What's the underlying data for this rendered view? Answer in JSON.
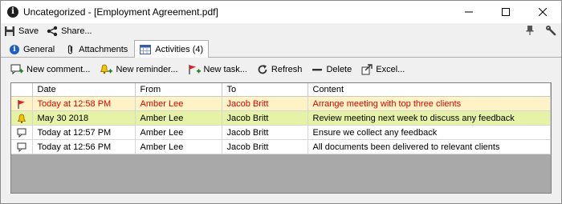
{
  "window": {
    "title": "Uncategorized - [Employment Agreement.pdf]"
  },
  "toolbar": {
    "save_label": "Save",
    "share_label": "Share..."
  },
  "tabs": [
    {
      "label": "General",
      "icon": "info-icon"
    },
    {
      "label": "Attachments",
      "icon": "paperclip-icon"
    },
    {
      "label": "Activities (4)",
      "icon": "calendar-icon",
      "active": true
    }
  ],
  "actions": {
    "new_comment": "New comment...",
    "new_reminder": "New reminder...",
    "new_task": "New task...",
    "refresh": "Refresh",
    "delete": "Delete",
    "excel": "Excel..."
  },
  "grid": {
    "columns": [
      "Date",
      "From",
      "To",
      "Content"
    ],
    "rows": [
      {
        "icon": "flag-icon",
        "date": "Today at 12:58 PM",
        "from": "Amber Lee",
        "to": "Jacob Britt",
        "content": "Arrange meeting with top three clients",
        "style": "red"
      },
      {
        "icon": "bell-icon",
        "date": "May 30 2018",
        "from": "Amber Lee",
        "to": "Jacob Britt",
        "content": "Review meeting next week to discuss any feedback",
        "style": "green"
      },
      {
        "icon": "comment-icon",
        "date": "Today at 12:57 PM",
        "from": "Amber Lee",
        "to": "Jacob Britt",
        "content": "Ensure we collect any feedback",
        "style": "normal"
      },
      {
        "icon": "comment-icon",
        "date": "Today at 12:56 PM",
        "from": "Amber Lee",
        "to": "Jacob Britt",
        "content": "All documents been delivered to relevant clients",
        "style": "normal"
      }
    ]
  },
  "colors": {
    "highlight_red_text": "#e00000",
    "highlight_yellow_row": "#fdf3c7",
    "highlight_green_row": "#e6f3a7",
    "grid_background": "#a9a9a9"
  }
}
